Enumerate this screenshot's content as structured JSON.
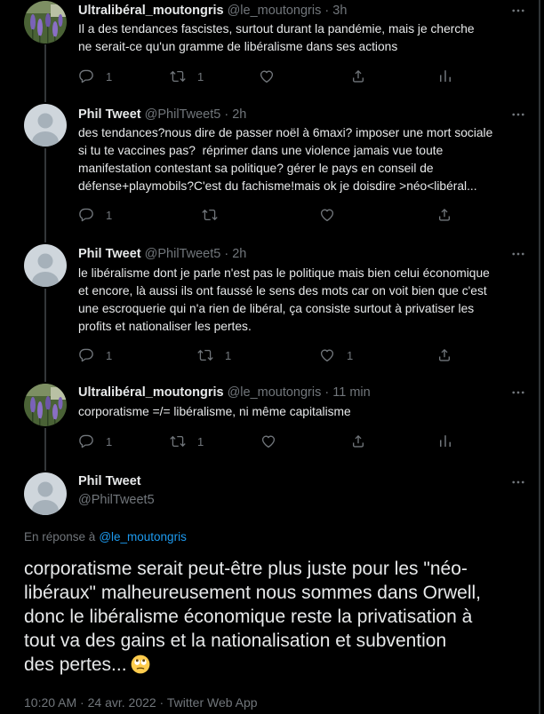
{
  "colors": {
    "background": "#000000",
    "text": "#e7e9ea",
    "secondary": "#71767b",
    "link": "#1d9bf0",
    "thread_line": "#333639"
  },
  "ui": {
    "dot": " · "
  },
  "icons": [
    "reply-icon",
    "retweet-icon",
    "like-icon",
    "share-icon",
    "analytics-icon",
    "more-icon"
  ],
  "thread": [
    {
      "name": "Ultralibéral_moutongris",
      "handle": "@le_moutongris",
      "time": "3h",
      "avatar": "lavender-flowers-avatar",
      "lines": [
        "Il a des tendances fascistes, surtout durant la pandémie, mais je cherche",
        "ne serait-ce qu'un gramme de libéralisme dans ses actions"
      ],
      "stats": {
        "reply": "1",
        "retweet": "1"
      }
    },
    {
      "name": "Phil Tweet",
      "handle": "@PhilTweet5",
      "time": "2h",
      "avatar": "default-avatar",
      "lines": [
        "des tendances?nous dire de passer noël à 6maxi? imposer une mort sociale",
        "si tu te vaccines pas?  réprimer dans une violence jamais vue toute",
        "manifestation contestant sa politique? gérer le pays en conseil de",
        "défense+playmobils?C'est du fachisme!mais ok je doisdire >néo<libéral..."
      ],
      "stats": {
        "reply": "1"
      }
    },
    {
      "name": "Phil Tweet",
      "handle": "@PhilTweet5",
      "time": "2h",
      "avatar": "default-avatar",
      "lines": [
        "le libéralisme dont je parle n'est pas le politique mais bien celui économique",
        "et encore, là aussi ils ont faussé le sens des mots car on voit bien que c'est",
        "une escroquerie qui n'a rien de libéral, ça consiste surtout à privatiser les",
        "profits et nationaliser les pertes."
      ],
      "stats": {
        "reply": "1",
        "retweet": "1",
        "like": "1"
      }
    },
    {
      "name": "Ultralibéral_moutongris",
      "handle": "@le_moutongris",
      "time": "11 min",
      "avatar": "lavender-flowers-avatar",
      "lines": [
        "corporatisme =/= libéralisme, ni même capitalisme"
      ],
      "stats": {
        "reply": "1",
        "retweet": "1"
      }
    }
  ],
  "main_tweet": {
    "name": "Phil Tweet",
    "handle": "@PhilTweet5",
    "avatar": "default-avatar",
    "reply_label": "En réponse à",
    "reply_to": "@le_moutongris",
    "lines": [
      "corporatisme serait peut-être plus juste pour les \"néo-",
      "libéraux\" malheureusement nous sommes dans Orwell,",
      "donc le libéralisme économique reste la privatisation à",
      "tout va des gains et la nationalisation et subvention",
      "des pertes..."
    ],
    "emoji": "face-with-rolling-eyes",
    "time": "10:20 AM",
    "date": "24 avr. 2022",
    "source": "Twitter Web App"
  }
}
